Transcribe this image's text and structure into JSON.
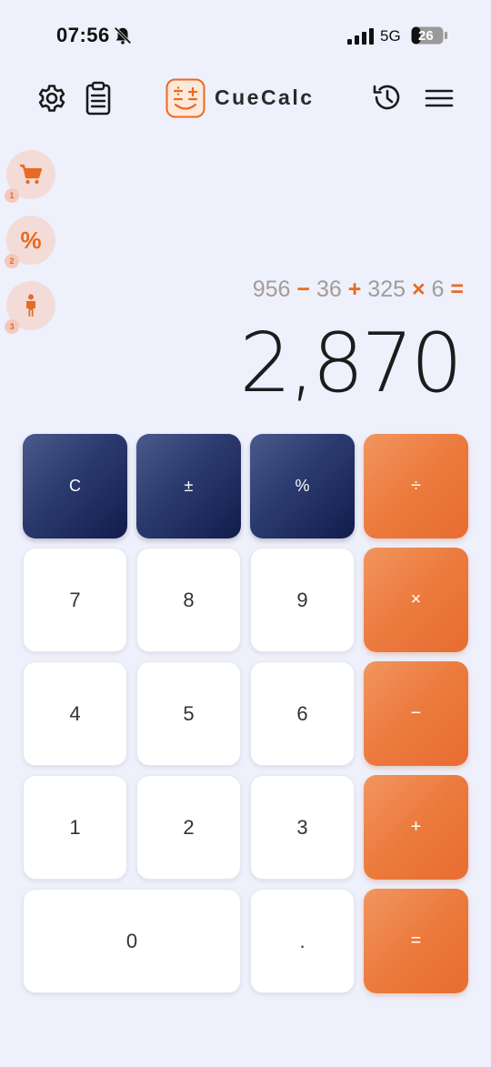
{
  "status": {
    "time": "07:56",
    "network": "5G",
    "battery": "26"
  },
  "header": {
    "app_name": "CueCalc"
  },
  "cues": [
    {
      "icon": "shopping-cart-icon",
      "index": "1"
    },
    {
      "label": "%",
      "index": "2"
    },
    {
      "icon": "person-icon",
      "index": "3"
    }
  ],
  "display": {
    "expression": {
      "n1": "956",
      "op1": "−",
      "n2": "36",
      "op2": "+",
      "n3": "325",
      "op3": "×",
      "n4": "6",
      "eq": "="
    },
    "result": "2,870"
  },
  "keypad": {
    "clear": "C",
    "sign": "±",
    "percent": "%",
    "divide": "÷",
    "seven": "7",
    "eight": "8",
    "nine": "9",
    "multiply": "×",
    "four": "4",
    "five": "5",
    "six": "6",
    "minus": "−",
    "one": "1",
    "two": "2",
    "three": "3",
    "plus": "+",
    "zero": "0",
    "decimal": ".",
    "equals": "="
  },
  "colors": {
    "accent": "#e96a22",
    "function_key": "#1f2b5e",
    "background": "#eef0fc"
  }
}
